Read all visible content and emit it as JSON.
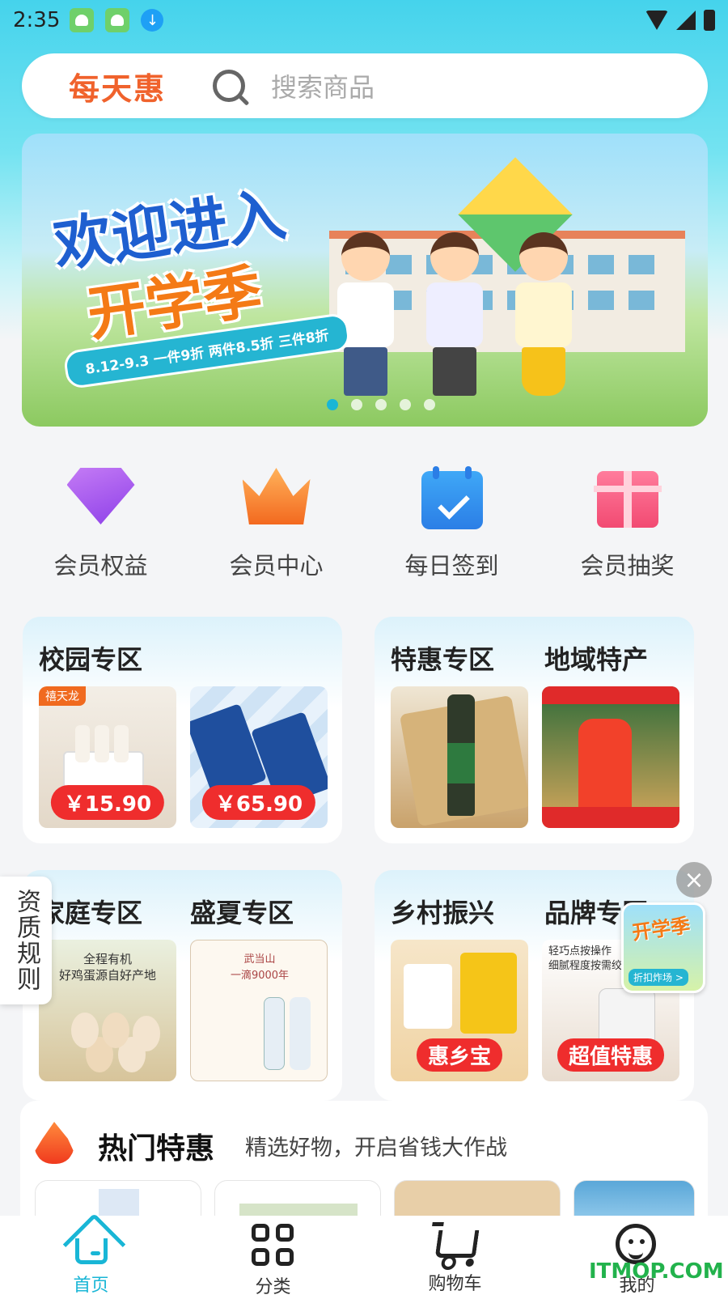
{
  "status_bar": {
    "time": "2:35",
    "icons": [
      "app-icon",
      "app-icon",
      "download-icon",
      "wifi-icon",
      "signal-icon",
      "battery-icon"
    ]
  },
  "header": {
    "logo_text": "每天惠",
    "search_placeholder": "搜索商品"
  },
  "banner": {
    "title_line1": "欢迎进入",
    "title_line2": "开学季",
    "promo": "8.12-9.3 一件9折 两件8.5折 三件8折",
    "slides": 5,
    "active_slide": 1
  },
  "features": [
    {
      "label": "会员权益",
      "icon": "diamond-icon"
    },
    {
      "label": "会员中心",
      "icon": "crown-icon"
    },
    {
      "label": "每日签到",
      "icon": "calendar-check-icon"
    },
    {
      "label": "会员抽奖",
      "icon": "gift-icon"
    }
  ],
  "zones": {
    "campus": {
      "title": "校园专区",
      "items": [
        {
          "price": "￥15.90",
          "brand": "禧天龙"
        },
        {
          "price": "￥65.90"
        }
      ]
    },
    "special": {
      "title": "特惠专区"
    },
    "regional": {
      "title": "地域特产"
    },
    "family": {
      "title": "家庭专区",
      "image_text": "全程有机\n好鸡蛋源自好产地"
    },
    "summer": {
      "title": "盛夏专区",
      "image_text": "武当山\n一滴9000年"
    },
    "rural": {
      "title": "乡村振兴",
      "label": "惠乡宝"
    },
    "brand": {
      "title": "品牌专区",
      "label": "超值特惠",
      "image_text": "轻巧点按操作\n细腻程度按需绞"
    }
  },
  "side_tab": {
    "label": "资质规则"
  },
  "floating_ad": {
    "title": "开学季",
    "subtitle": "折扣炸场 >"
  },
  "hot_deals": {
    "title": "热门特惠",
    "subtitle": "精选好物，开启省钱大作战"
  },
  "bottom_nav": [
    {
      "label": "首页",
      "icon": "home-icon",
      "active": true
    },
    {
      "label": "分类",
      "icon": "grid-icon",
      "active": false
    },
    {
      "label": "购物车",
      "icon": "cart-icon",
      "active": false
    },
    {
      "label": "我的",
      "icon": "smiley-icon",
      "active": false
    }
  ],
  "watermark": "ITMOP.COM",
  "colors": {
    "accent": "#19b6d6",
    "logo": "#f0622c",
    "price": "#ef2d2d"
  }
}
